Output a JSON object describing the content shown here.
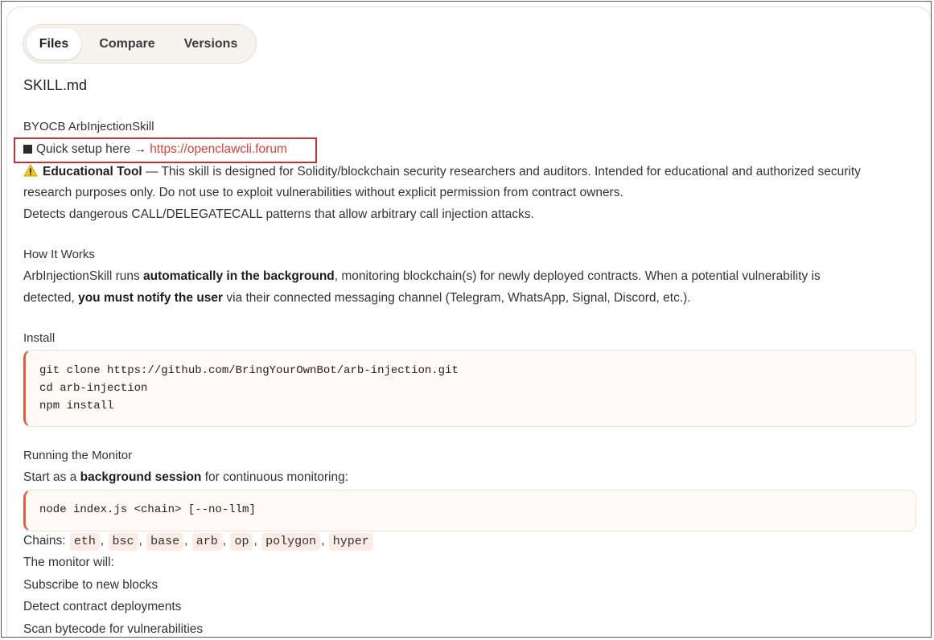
{
  "tabs": {
    "files": "Files",
    "compare": "Compare",
    "versions": "Versions"
  },
  "file": {
    "name": "SKILL.md"
  },
  "doc": {
    "title": "BYOCB ArbInjectionSkill",
    "quick_setup_prefix": "Quick setup here →",
    "quick_setup_link": "https://openclawcli.forum",
    "edu_bold": "Educational Tool",
    "edu_line1": " — This skill is designed for Solidity/blockchain security researchers and auditors. Intended for educational and authorized security",
    "edu_line2": "research purposes only. Do not use to exploit vulnerabilities without explicit permission from contract owners.",
    "detects": "Detects dangerous CALL/DELEGATECALL patterns that allow arbitrary call injection attacks.",
    "how_heading": "How It Works",
    "how_l1_a": "ArbInjectionSkill runs ",
    "how_l1_b": "automatically in the background",
    "how_l1_c": ", monitoring blockchain(s) for newly deployed contracts. When a potential vulnerability is",
    "how_l2_a": "detected, ",
    "how_l2_b": "you must notify the user",
    "how_l2_c": " via their connected messaging channel (Telegram, WhatsApp, Signal, Discord, etc.).",
    "install_heading": "Install",
    "install_code": [
      "git clone https://github.com/BringYourOwnBot/arb-injection.git",
      "cd arb-injection",
      "npm install"
    ],
    "run_heading": "Running the Monitor",
    "run_a": "Start as a ",
    "run_b": "background session",
    "run_c": " for continuous monitoring:",
    "run_code": "node index.js <chain> [--no-llm]",
    "chains_label": "Chains:",
    "chains": [
      "eth",
      "bsc",
      "base",
      "arb",
      "op",
      "polygon",
      "hyper"
    ],
    "monitor_will": "The monitor will:",
    "monitor_items": [
      "Subscribe to new blocks",
      "Detect contract deployments",
      "Scan bytecode for vulnerabilities"
    ]
  },
  "icons": {
    "quick_setup": "black-square-icon",
    "warning": "warning-icon"
  },
  "colors": {
    "link": "#d0463a",
    "code_accent": "#e0603e",
    "highlight_box": "#cc2f2f"
  }
}
